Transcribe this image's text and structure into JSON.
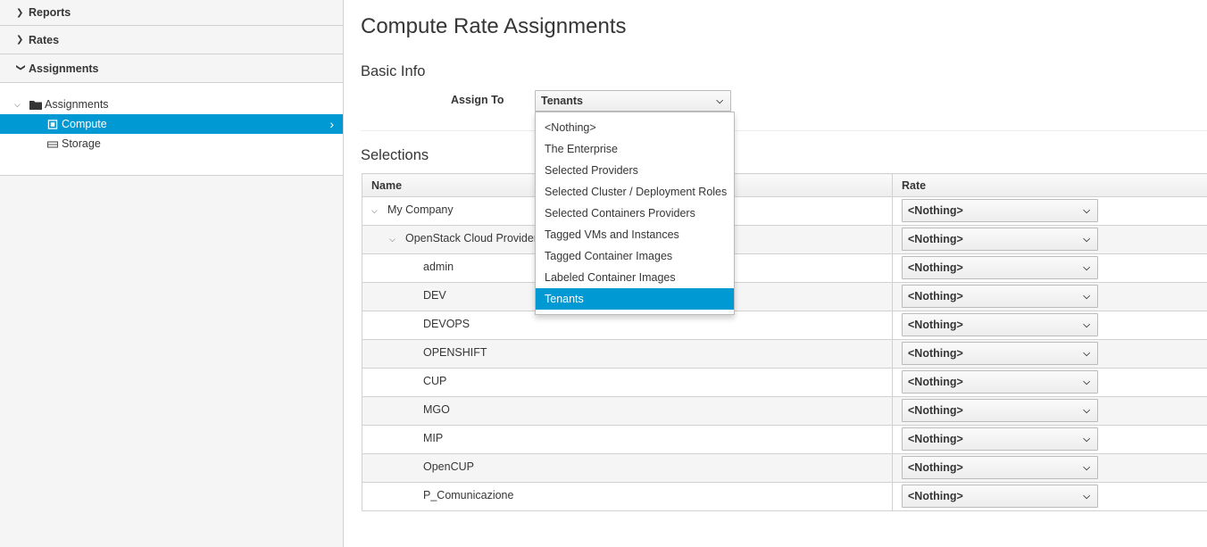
{
  "sidebar": {
    "accordion": [
      {
        "label": "Reports",
        "expanded": false
      },
      {
        "label": "Rates",
        "expanded": false
      },
      {
        "label": "Assignments",
        "expanded": true
      }
    ],
    "tree": {
      "root": "Assignments",
      "items": [
        {
          "label": "Compute",
          "selected": true
        },
        {
          "label": "Storage",
          "selected": false
        }
      ]
    }
  },
  "main": {
    "title": "Compute Rate Assignments",
    "basic_info": "Basic Info",
    "assign_to_label": "Assign To",
    "assign_to_value": "Tenants",
    "dropdown_options": [
      "<Nothing>",
      "The Enterprise",
      "Selected Providers",
      "Selected Cluster / Deployment Roles",
      "Selected Containers Providers",
      "Tagged VMs and Instances",
      "Tagged Container Images",
      "Labeled Container Images",
      "Tenants"
    ],
    "selections": "Selections",
    "table": {
      "columns": [
        "Name",
        "Rate"
      ],
      "rows": [
        {
          "name": "My Company",
          "level": 0,
          "expander": true,
          "rate": "<Nothing>"
        },
        {
          "name": "OpenStack Cloud Provider",
          "level": 1,
          "expander": true,
          "rate": "<Nothing>"
        },
        {
          "name": "admin",
          "level": 2,
          "expander": false,
          "rate": "<Nothing>"
        },
        {
          "name": "DEV",
          "level": 2,
          "expander": false,
          "rate": "<Nothing>"
        },
        {
          "name": "DEVOPS",
          "level": 2,
          "expander": false,
          "rate": "<Nothing>"
        },
        {
          "name": "OPENSHIFT",
          "level": 2,
          "expander": false,
          "rate": "<Nothing>"
        },
        {
          "name": "CUP",
          "level": 2,
          "expander": false,
          "rate": "<Nothing>"
        },
        {
          "name": "MGO",
          "level": 2,
          "expander": false,
          "rate": "<Nothing>"
        },
        {
          "name": "MIP",
          "level": 2,
          "expander": false,
          "rate": "<Nothing>"
        },
        {
          "name": "OpenCUP",
          "level": 2,
          "expander": false,
          "rate": "<Nothing>"
        },
        {
          "name": "P_Comunicazione",
          "level": 2,
          "expander": false,
          "rate": "<Nothing>"
        }
      ]
    }
  },
  "colors": {
    "accent": "#0099d3",
    "sidebar_bg": "#f5f5f5",
    "border": "#d1d1d1"
  }
}
